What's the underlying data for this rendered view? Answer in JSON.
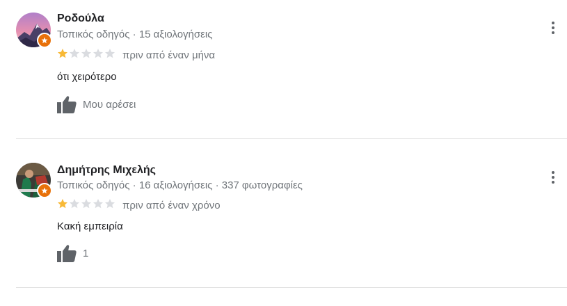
{
  "colors": {
    "star_filled": "#f8b936",
    "star_empty": "#dadce0",
    "secondary_text": "#70757a",
    "badge": "#e8710a",
    "divider": "#e0e0e0"
  },
  "reviews": [
    {
      "name": "Ροδούλα",
      "meta": "Τοπικός οδηγός · 15 αξιολογήσεις",
      "rating": 1,
      "rating_max": 5,
      "time": "πριν από έναν μήνα",
      "text": "ότι χειρότερο",
      "like_label": "Μου αρέσει",
      "icons": {
        "like": "thumbs-up-icon",
        "more": "more-vert-icon",
        "badge": "local-guide-badge-icon"
      }
    },
    {
      "name": "Δημήτρης Μιχελής",
      "meta": "Τοπικός οδηγός · 16 αξιολογήσεις · 337 φωτογραφίες",
      "rating": 1,
      "rating_max": 5,
      "time": "πριν από έναν χρόνο",
      "text": "Κακή εμπειρία",
      "like_label": "1",
      "icons": {
        "like": "thumbs-up-icon",
        "more": "more-vert-icon",
        "badge": "local-guide-badge-icon"
      }
    }
  ]
}
